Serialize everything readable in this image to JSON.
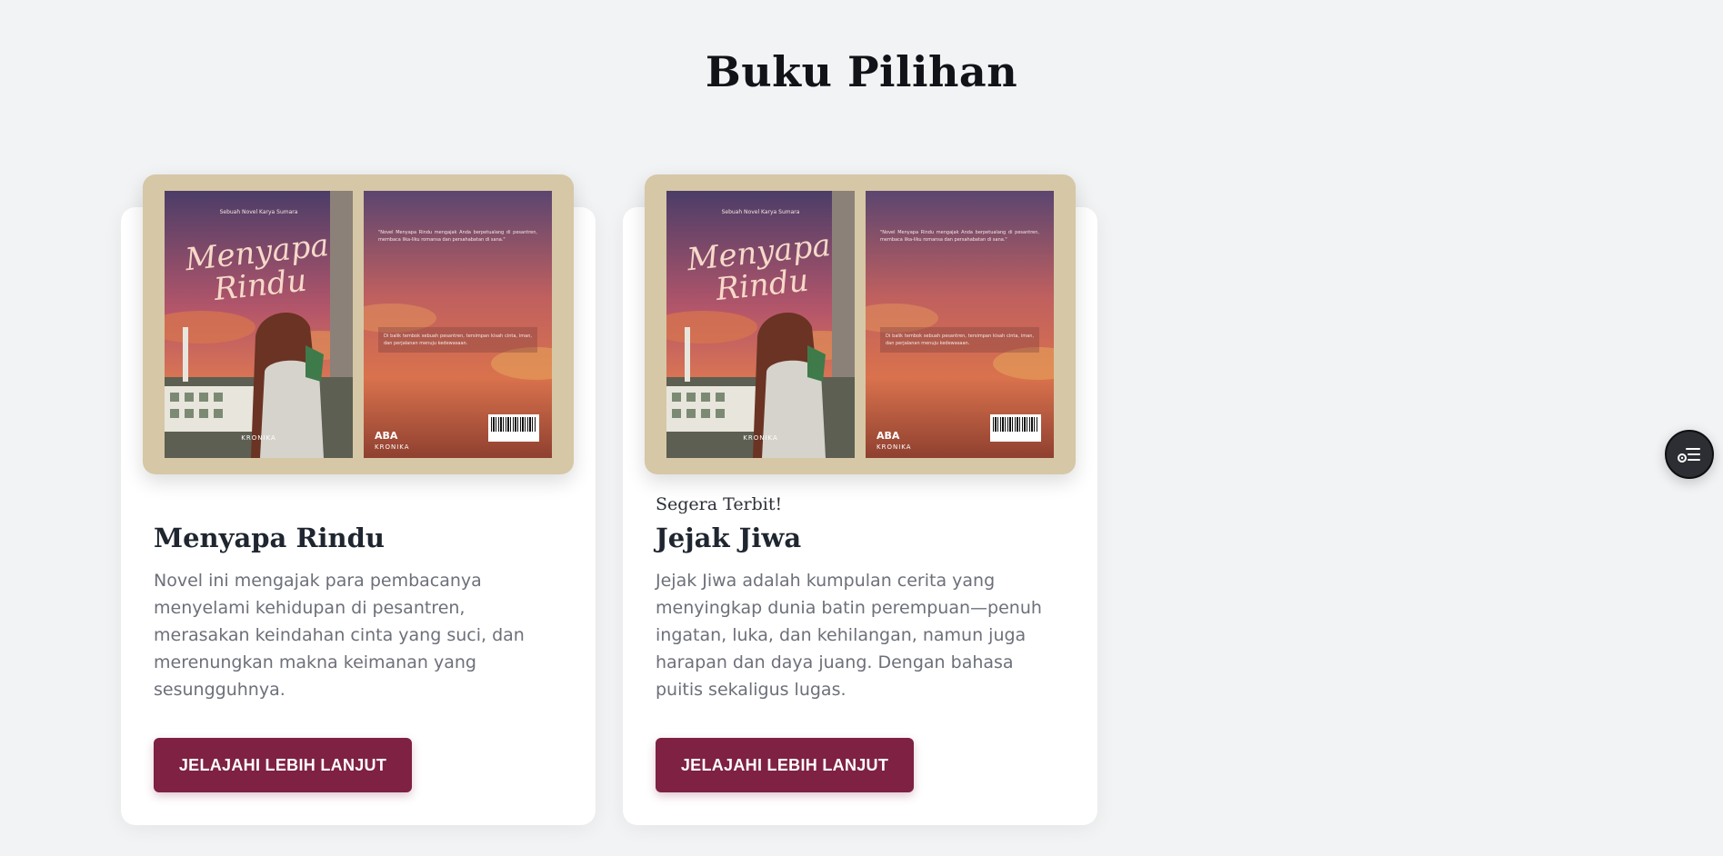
{
  "section": {
    "title": "Buku Pilihan"
  },
  "books": [
    {
      "eyebrow": "",
      "title": "Menyapa Rindu",
      "description": "Novel ini mengajak para pembacanya menyelami kehidupan di pesantren, merasakan keindahan cinta yang suci, dan merenungkan makna keimanan yang sesungguhnya.",
      "button_label": "JELAJAHI LEBIH LANJUT",
      "cover": {
        "front_title": "Menyapa Rindu",
        "front_author": "Sebuah Novel Karya Sumara",
        "publisher": "KRONIKA",
        "logo": "ABA"
      }
    },
    {
      "eyebrow": "Segera Terbit!",
      "title": "Jejak Jiwa",
      "description": "Jejak Jiwa adalah kumpulan cerita yang menyingkap dunia batin perempuan—penuh ingatan, luka, dan kehilangan, namun juga harapan dan daya juang. Dengan bahasa puitis sekaligus lugas.",
      "button_label": "JELAJAHI LEBIH LANJUT",
      "cover": {
        "front_title": "Menyapa Rindu",
        "front_author": "Sebuah Novel Karya Sumara",
        "publisher": "KRONIKA",
        "logo": "ABA"
      }
    }
  ],
  "floating_button": {
    "icon": "list-settings-icon"
  },
  "colors": {
    "background": "#f2f3f5",
    "accent": "#7e2142",
    "cover_frame": "#d6c7a6"
  }
}
